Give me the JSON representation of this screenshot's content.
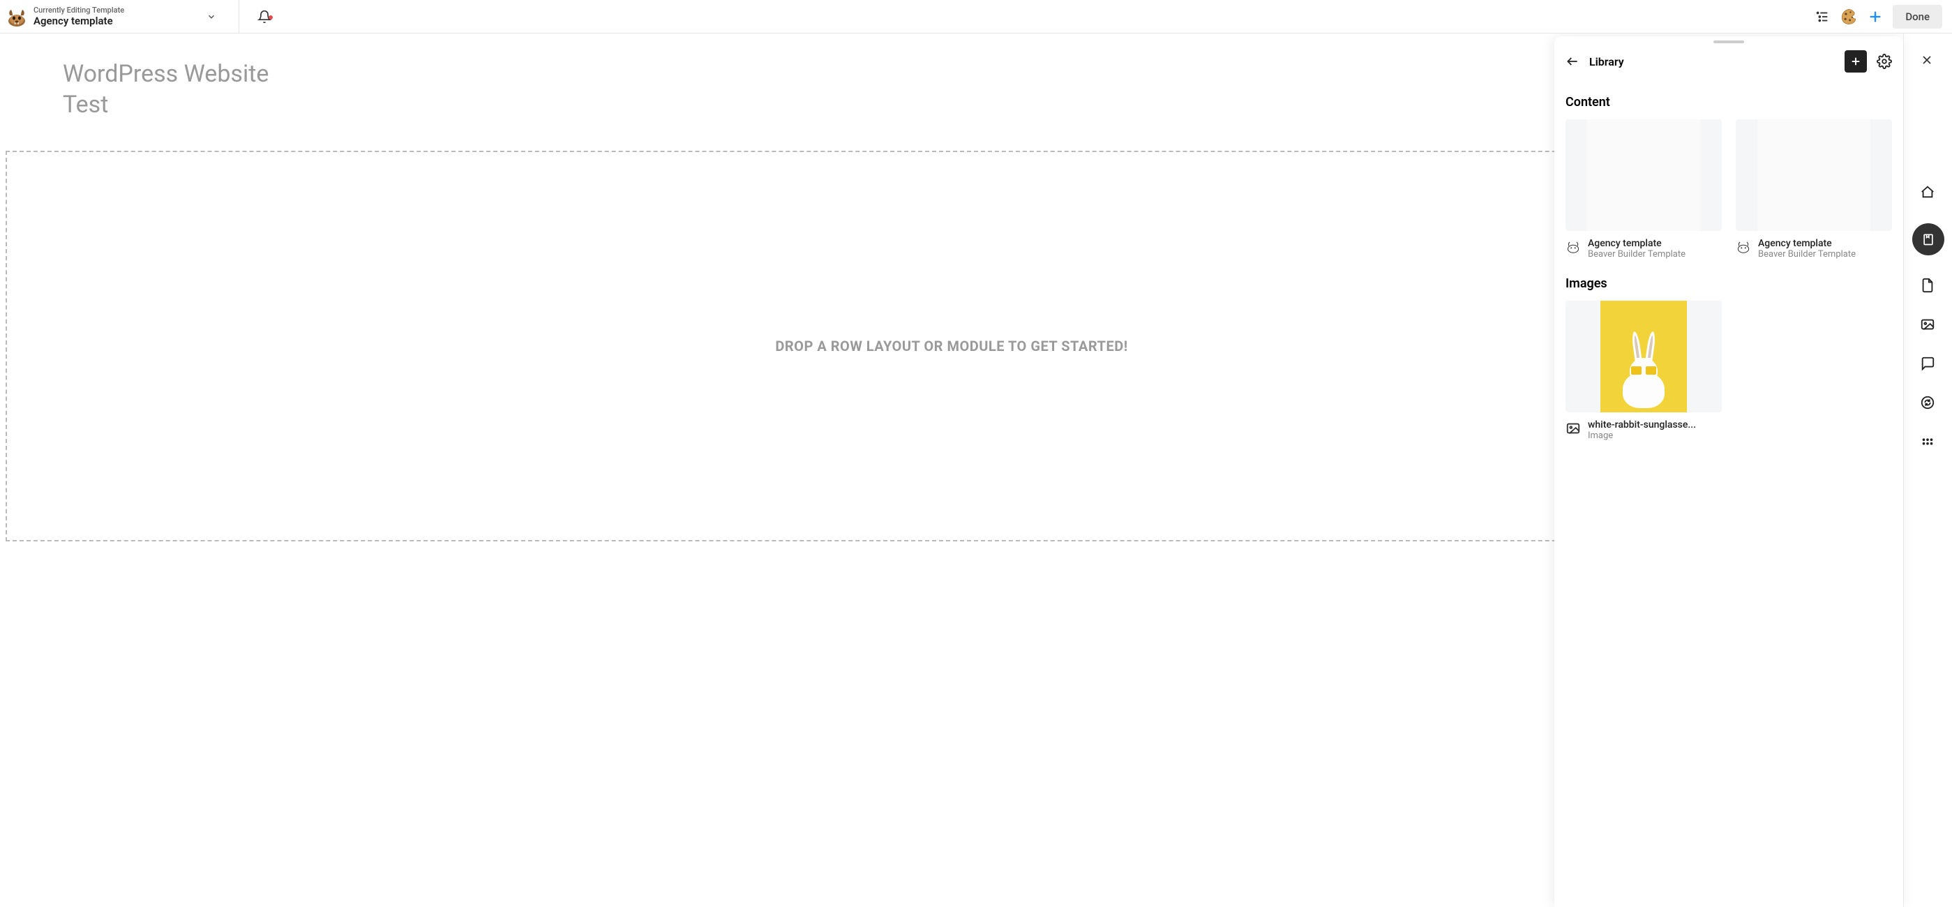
{
  "topbar": {
    "template_label": "Currently Editing Template",
    "template_name": "Agency template",
    "done_label": "Done"
  },
  "page": {
    "title_line1": "WordPress Website",
    "title_line2": "Test",
    "drop_text": "DROP A ROW LAYOUT OR MODULE TO GET STARTED!"
  },
  "library": {
    "title": "Library",
    "sections": {
      "content": {
        "heading": "Content",
        "items": [
          {
            "title": "Agency template",
            "subtitle": "Beaver Builder Template"
          },
          {
            "title": "Agency template",
            "subtitle": "Beaver Builder Template"
          }
        ]
      },
      "images": {
        "heading": "Images",
        "items": [
          {
            "title": "white-rabbit-sunglasse...",
            "subtitle": "Image"
          }
        ]
      }
    }
  }
}
